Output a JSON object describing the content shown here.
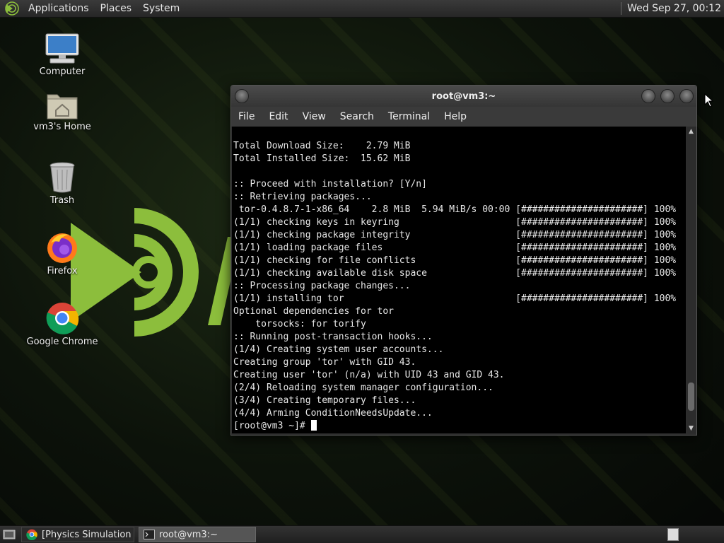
{
  "top_panel": {
    "menus": [
      "Applications",
      "Places",
      "System"
    ],
    "clock": "Wed Sep 27, 00:12"
  },
  "desktop_icons": [
    {
      "label": "Computer",
      "icon": "computer-icon"
    },
    {
      "label": "vm3's Home",
      "icon": "home-folder-icon"
    },
    {
      "label": "Trash",
      "icon": "trash-icon"
    },
    {
      "label": "Firefox",
      "icon": "firefox-icon"
    },
    {
      "label": "Google Chrome",
      "icon": "chrome-icon"
    }
  ],
  "terminal": {
    "title": "root@vm3:~",
    "menu": [
      "File",
      "Edit",
      "View",
      "Search",
      "Terminal",
      "Help"
    ],
    "lines": [
      "Total Download Size:    2.79 MiB",
      "Total Installed Size:  15.62 MiB",
      "",
      ":: Proceed with installation? [Y/n]",
      ":: Retrieving packages...",
      " tor-0.4.8.7-1-x86_64    2.8 MiB  5.94 MiB/s 00:00 [######################] 100%",
      "(1/1) checking keys in keyring                     [######################] 100%",
      "(1/1) checking package integrity                   [######################] 100%",
      "(1/1) loading package files                        [######################] 100%",
      "(1/1) checking for file conflicts                  [######################] 100%",
      "(1/1) checking available disk space                [######################] 100%",
      ":: Processing package changes...",
      "(1/1) installing tor                               [######################] 100%",
      "Optional dependencies for tor",
      "    torsocks: for torify",
      ":: Running post-transaction hooks...",
      "(1/4) Creating system user accounts...",
      "Creating group 'tor' with GID 43.",
      "Creating user 'tor' (n/a) with UID 43 and GID 43.",
      "(2/4) Reloading system manager configuration...",
      "(3/4) Creating temporary files...",
      "(4/4) Arming ConditionNeedsUpdate..."
    ],
    "prompt": "[root@vm3 ~]# ",
    "scroll_position": 0.95
  },
  "taskbar": {
    "tasks": [
      {
        "label": "[Physics Simulation ...",
        "icon": "chrome-icon",
        "active": false
      },
      {
        "label": "root@vm3:~",
        "icon": "terminal-icon",
        "active": true
      }
    ]
  },
  "colors": {
    "accent_green": "#8cbe3c",
    "terminal_bg": "#000000"
  }
}
